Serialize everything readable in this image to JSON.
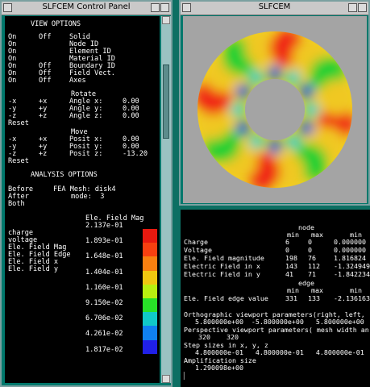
{
  "control_panel": {
    "title": "SLFCEM Control Panel",
    "view_options_header": "VIEW OPTIONS",
    "view_rows": [
      {
        "on": "On",
        "off": "Off",
        "label": "Solid"
      },
      {
        "on": "On",
        "off": "",
        "label": "Node ID"
      },
      {
        "on": "On",
        "off": "",
        "label": "Element ID"
      },
      {
        "on": "On",
        "off": "",
        "label": "Material ID"
      },
      {
        "on": "On",
        "off": "Off",
        "label": "Boundary ID"
      },
      {
        "on": "On",
        "off": "Off",
        "label": "Field Vect."
      },
      {
        "on": "On",
        "off": "Off",
        "label": "Axes"
      }
    ],
    "rotate": {
      "header": "Rotate",
      "rows": [
        {
          "minus": "-x",
          "plus": "+x",
          "label": "Angle x:",
          "value": "0.00"
        },
        {
          "minus": "-y",
          "plus": "+y",
          "label": "Angle y:",
          "value": "0.00"
        },
        {
          "minus": "-z",
          "plus": "+z",
          "label": "Angle z:",
          "value": "0.00"
        }
      ],
      "reset": "Reset"
    },
    "move": {
      "header": "Move",
      "rows": [
        {
          "minus": "-x",
          "plus": "+x",
          "label": "Posit x:",
          "value": "0.00"
        },
        {
          "minus": "-y",
          "plus": "+y",
          "label": "Posit y:",
          "value": "0.00"
        },
        {
          "minus": "-z",
          "plus": "+z",
          "label": "Posit z:",
          "value": "-13.20"
        }
      ],
      "reset": "Reset"
    },
    "analysis_header": "ANALYSIS OPTIONS",
    "before": "Before",
    "mesh": "FEA Mesh: disk4",
    "after": "After",
    "mode": "mode:  3",
    "both": "Both",
    "legend_title": "Ele. Field Mag",
    "field_items": [
      "charge",
      "voltage",
      "Ele. Field Mag",
      "Ele. Field Edge",
      "Ele. Field x",
      "Ele. Field y"
    ],
    "scale_values": [
      "2.137e-01",
      "1.893e-01",
      "1.648e-01",
      "1.404e-01",
      "1.160e-01",
      "9.150e-02",
      "6.706e-02",
      "4.261e-02",
      "1.817e-02"
    ],
    "scale_colors": [
      "#e8190f",
      "#f84010",
      "#f88010",
      "#f0c810",
      "#b8f010",
      "#28e028",
      "#10c8c8",
      "#1080f0",
      "#2020e8"
    ]
  },
  "viewport": {
    "title": "SLFCEM"
  },
  "console": {
    "header1": "node",
    "header2": "min   max",
    "header2b": "min",
    "rows": [
      {
        "label": "Charge",
        "min": "6",
        "max": "0",
        "val": "0.000000"
      },
      {
        "label": "Voltage",
        "min": "0",
        "max": "0",
        "val": "0.000000"
      },
      {
        "label": "Ele. Field magnitude",
        "min": "198",
        "max": "76",
        "val": "1.816824"
      },
      {
        "label": "Electric Field in x",
        "min": "143",
        "max": "112",
        "val": "-1.324949"
      },
      {
        "label": "Electric Field in y",
        "min": "41",
        "max": "71",
        "val": "-1.842234"
      }
    ],
    "edge_header": "edge",
    "edge_sub": "min   max",
    "edge_sub_b": "min",
    "edge_row": {
      "label": "Ele. Field edge value",
      "min": "331",
      "max": "133",
      "val": "-2.136163"
    },
    "ortho_label": "Orthographic viewport parameters(right, left,",
    "ortho_values": "5.800000e+00  -5.800000e+00   5.800000e+00",
    "persp_label": "Perspective viewport parameters( mesh width an",
    "persp_values": "320    320",
    "step_label": "Step sizes in x, y, z",
    "step_values": "4.800000e-01   4.800000e-01   4.800000e-01",
    "amp_label": "Amplification size",
    "amp_value": "1.290098e+00",
    "prompt": "▏"
  }
}
